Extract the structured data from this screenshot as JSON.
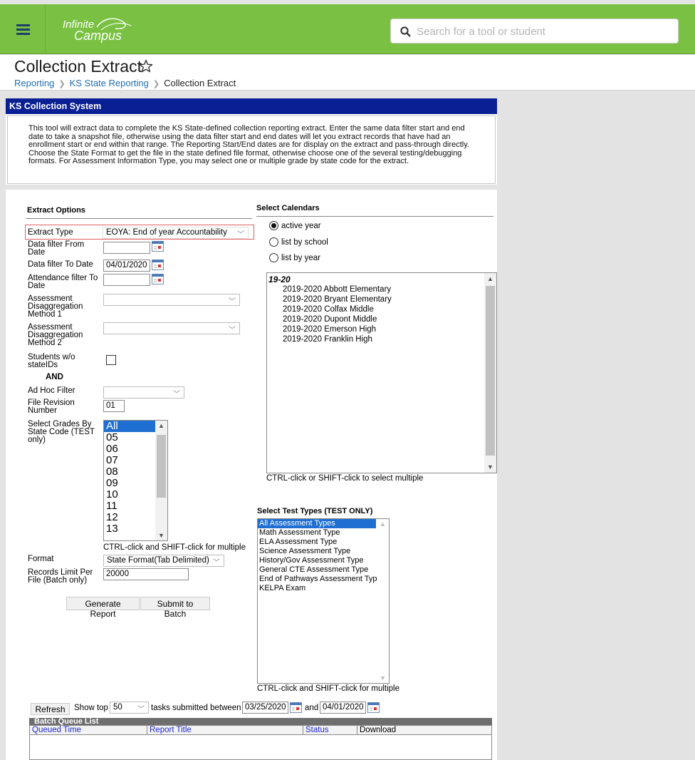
{
  "app": {
    "logo_line1": "Infinite",
    "logo_line2": "Campus",
    "search_placeholder": "Search for a tool or student"
  },
  "header": {
    "title": "Collection Extract",
    "breadcrumb": [
      "Reporting",
      "KS State Reporting",
      "Collection Extract"
    ]
  },
  "section_title": "KS Collection System",
  "description": "This tool will extract data to complete the KS State-defined collection reporting extract. Enter the same data filter start and end date to take a snapshot file, otherwise using the data filter start and end dates will let you extract records that have had an enrollment start or end within that range. The Reporting Start/End dates are for display on the extract and pass-through directly. Choose the State Format to get the file in the state defined file format, otherwise choose one of the several testing/debugging formats. For Assessment Information Type, you may select one or multiple grade by state code for the extract.",
  "extract_options": {
    "heading": "Extract Options",
    "extract_type_label": "Extract Type",
    "extract_type_value": "EOYA: End of year Accountability",
    "data_from_label": "Data filter From Date",
    "data_from_value": "",
    "data_to_label": "Data filter To Date",
    "data_to_value": "04/01/2020",
    "attendance_to_label": "Attendance filter To Date",
    "attendance_to_value": "",
    "disagg1_label": "Assessment Disaggregation Method 1",
    "disagg1_value": "",
    "disagg2_label": "Assessment Disaggregation Method 2",
    "disagg2_value": "",
    "no_stateid_label": "Students w/o stateIDs",
    "and_label": "AND",
    "adhoc_label": "Ad Hoc Filter",
    "adhoc_value": "",
    "file_revision_label": "File Revision Number",
    "file_revision_value": "01",
    "grades_label": "Select Grades By State Code (TEST only)",
    "grades": [
      "All Grades",
      "05",
      "06",
      "07",
      "08",
      "09",
      "10",
      "11",
      "12",
      "13"
    ],
    "grades_hint": "CTRL-click and SHIFT-click for multiple",
    "format_label": "Format",
    "format_value": "State Format(Tab Delimited)",
    "records_limit_label": "Records Limit Per File (Batch only)",
    "records_limit_value": "20000",
    "generate_button": "Generate Report",
    "batch_button": "Submit to Batch"
  },
  "calendars": {
    "heading": "Select Calendars",
    "radio_active": "active year",
    "radio_school": "list by school",
    "radio_year": "list by year",
    "group": "19-20",
    "items": [
      "2019-2020 Abbott Elementary",
      "2019-2020 Bryant Elementary",
      "2019-2020 Colfax Middle",
      "2019-2020 Dupont Middle",
      "2019-2020 Emerson High",
      "2019-2020 Franklin High"
    ],
    "hint": "CTRL-click or SHIFT-click to select multiple"
  },
  "test_types": {
    "heading": "Select Test Types (TEST ONLY)",
    "items": [
      "All Assessment Types",
      "Math Assessment Type",
      "ELA Assessment Type",
      "Science Assessment Type",
      "History/Gov Assessment Type",
      "General CTE Assessment Type",
      "End of Pathways Assessment Type",
      "KELPA Exam"
    ],
    "hint": "CTRL-click and SHIFT-click for multiple"
  },
  "batch": {
    "refresh_button": "Refresh",
    "show_top_label": "Show top",
    "show_top_value": "50",
    "between_label": "tasks submitted between",
    "start_date": "03/25/2020",
    "and_label": "and",
    "end_date": "04/01/2020",
    "list_title": "Batch Queue List",
    "columns": [
      "Queued Time",
      "Report Title",
      "Status",
      "Download"
    ]
  }
}
